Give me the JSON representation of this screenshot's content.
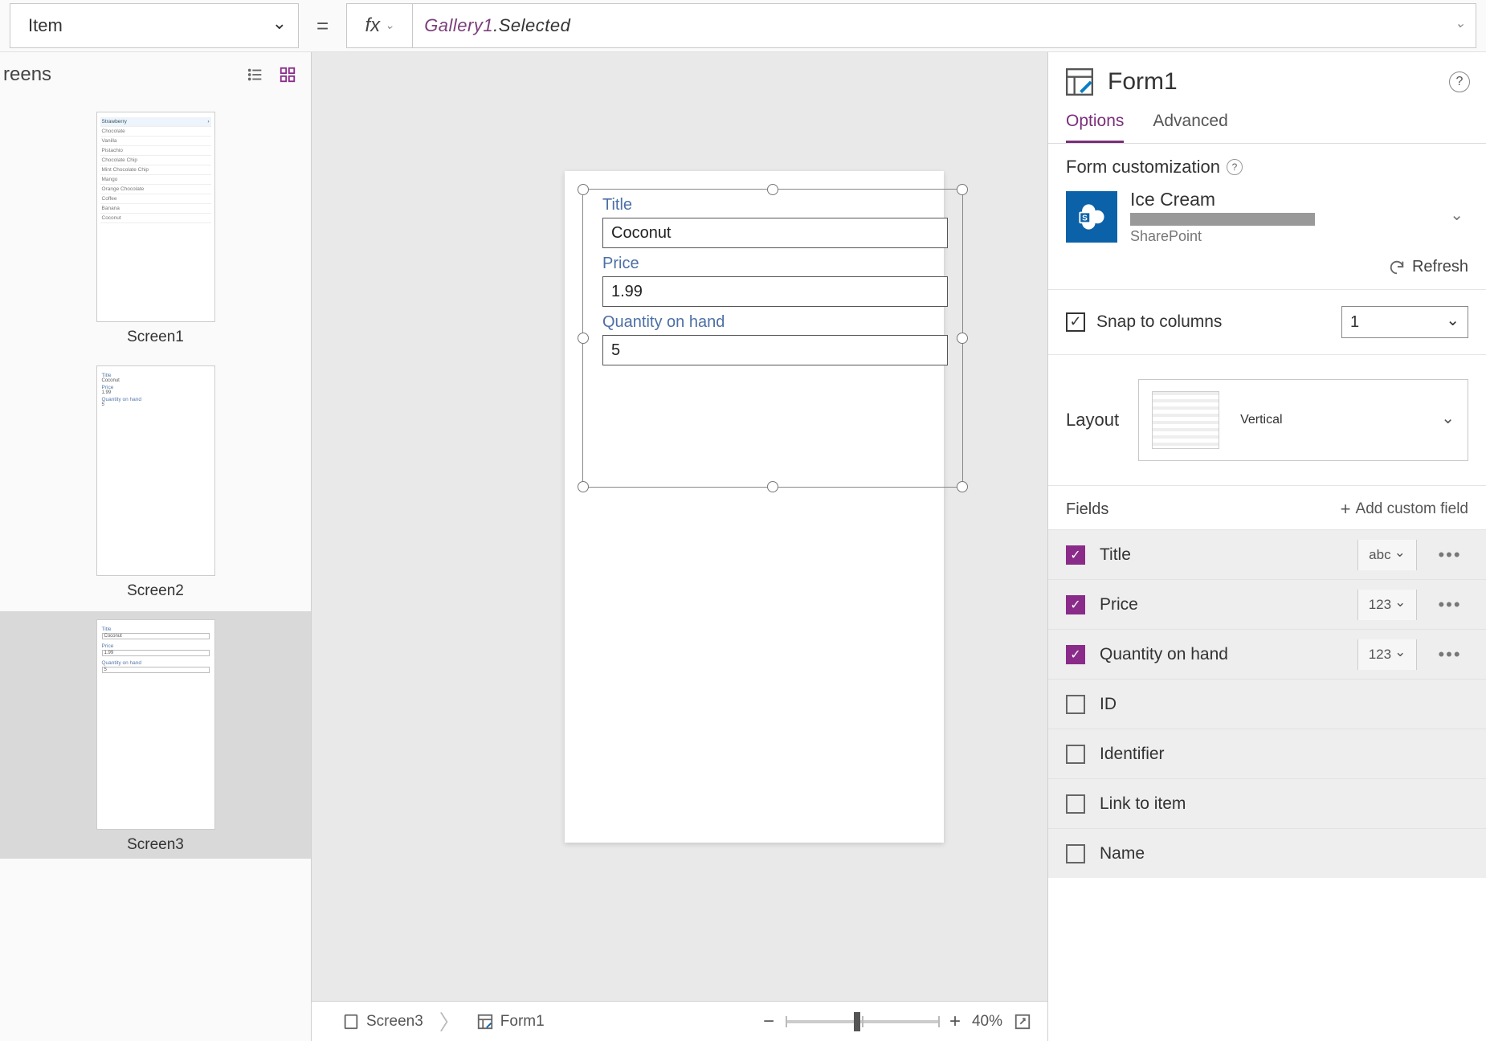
{
  "topbar": {
    "property": "Item",
    "formula_ident": "Gallery1",
    "formula_chain": ".Selected"
  },
  "tree": {
    "header": "reens",
    "screens": [
      "Screen1",
      "Screen2",
      "Screen3"
    ],
    "thumb1_items": [
      "Strawberry",
      "Chocolate",
      "Vanilla",
      "Pistachio",
      "Chocolate Chip",
      "Mint Chocolate Chip",
      "Mango",
      "Orange Chocolate",
      "Coffee",
      "Banana",
      "Coconut"
    ]
  },
  "canvas": {
    "fields": [
      {
        "label": "Title",
        "value": "Coconut"
      },
      {
        "label": "Price",
        "value": "1.99"
      },
      {
        "label": "Quantity on hand",
        "value": "5"
      }
    ]
  },
  "breadcrumb": {
    "screen": "Screen3",
    "form": "Form1",
    "zoom": "40%"
  },
  "prop": {
    "title": "Form1",
    "tabs": {
      "options": "Options",
      "advanced": "Advanced"
    },
    "formcust": "Form customization",
    "datasource": {
      "name": "Ice Cream",
      "platform": "SharePoint"
    },
    "refresh": "Refresh",
    "snap": "Snap to columns",
    "cols": "1",
    "layout": {
      "label": "Layout",
      "value": "Vertical"
    },
    "fieldsHeader": "Fields",
    "addField": "Add custom field",
    "fields": [
      {
        "name": "Title",
        "on": true,
        "type": "abc"
      },
      {
        "name": "Price",
        "on": true,
        "type": "123"
      },
      {
        "name": "Quantity on hand",
        "on": true,
        "type": "123"
      },
      {
        "name": "ID",
        "on": false
      },
      {
        "name": "Identifier",
        "on": false
      },
      {
        "name": "Link to item",
        "on": false
      },
      {
        "name": "Name",
        "on": false
      }
    ]
  }
}
